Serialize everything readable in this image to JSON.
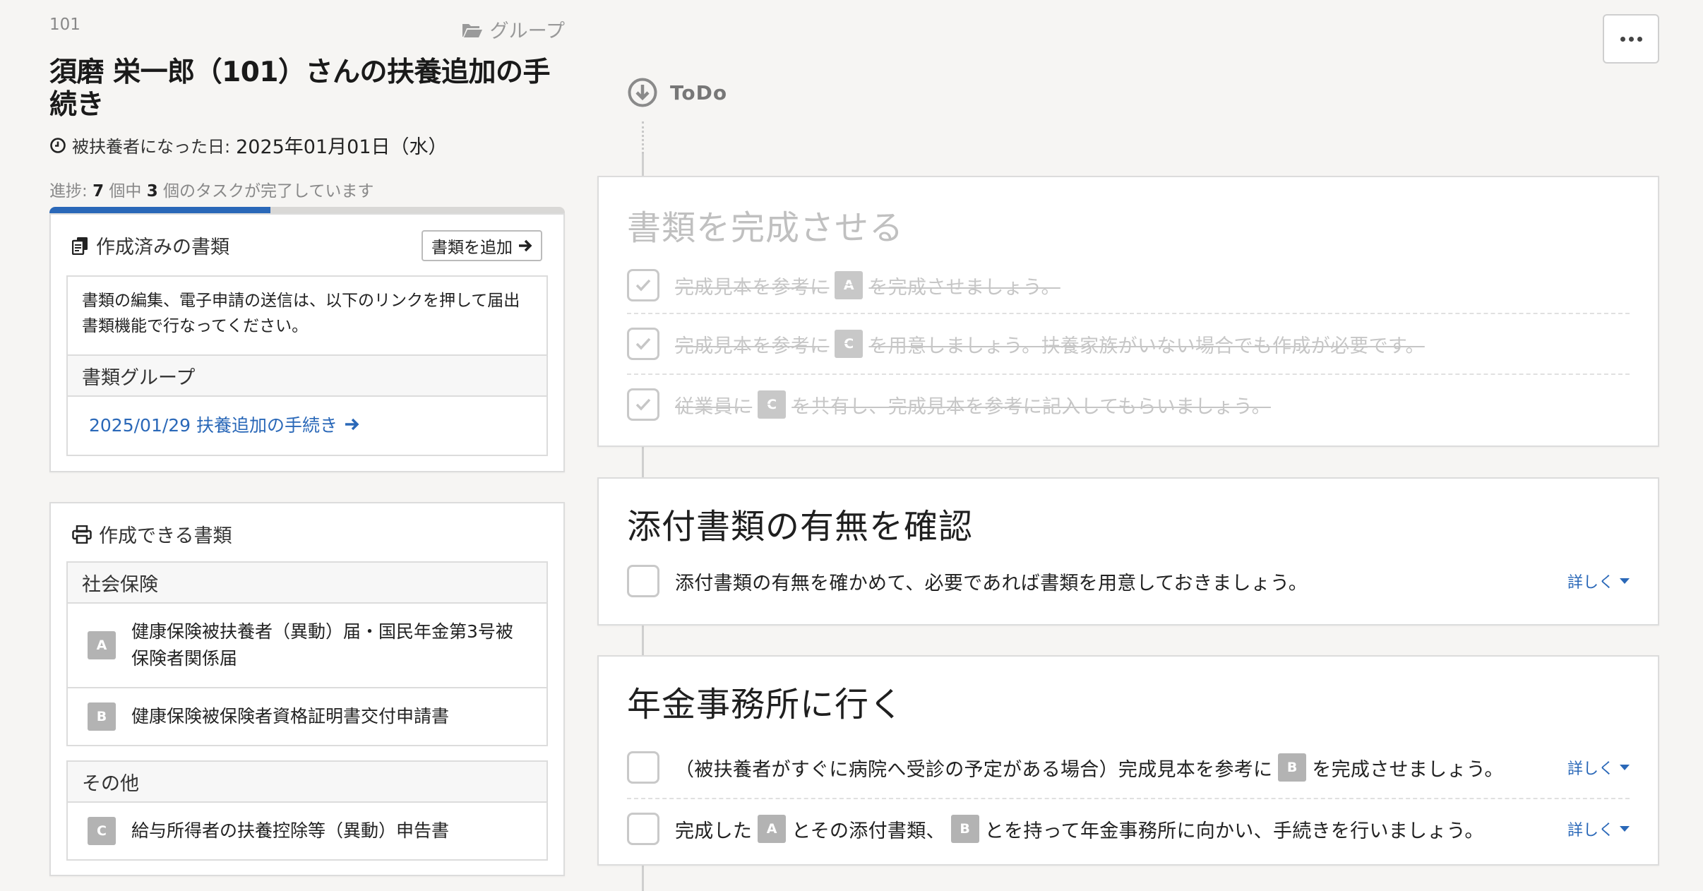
{
  "header": {
    "employee_id": "101",
    "group_label": "グループ",
    "title": "須磨 栄一郎（101）さんの扶養追加の手続き",
    "date_label": "被扶養者になった日:",
    "date_value": "2025年01月01日（水）",
    "progress": {
      "prefix": "進捗:",
      "total": "7",
      "mid": "個中",
      "done": "3",
      "suffix": "個のタスクが完了しています",
      "fraction": 0.4286
    }
  },
  "docs_made": {
    "title": "作成済みの書類",
    "add_button": "書類を追加",
    "description": "書類の編集、電子申請の送信は、以下のリンクを押して届出書類機能で行なってください。",
    "group_header": "書類グループ",
    "link_text": "2025/01/29 扶養追加の手続き"
  },
  "docs_can": {
    "title": "作成できる書類",
    "sections": [
      {
        "name": "社会保険",
        "items": [
          {
            "badge": "A",
            "label": "健康保険被扶養者（異動）届・国民年金第3号被保険者関係届"
          },
          {
            "badge": "B",
            "label": "健康保険被保険者資格証明書交付申請書"
          }
        ]
      },
      {
        "name": "その他",
        "items": [
          {
            "badge": "C",
            "label": "給与所得者の扶養控除等（異動）申告書"
          }
        ]
      }
    ]
  },
  "timeline": {
    "todo_label": "ToDo",
    "cards": [
      {
        "title": "書類を完成させる",
        "tasks": [
          {
            "pre": "完成見本を参考に",
            "badge": "A",
            "post": "を完成させましょう。",
            "done": true
          },
          {
            "pre": "完成見本を参考に",
            "badge": "C",
            "post": "を用意しましょう。扶養家族がいない場合でも作成が必要です。",
            "done": true
          },
          {
            "pre": "従業員に",
            "badge": "C",
            "post": "を共有し、完成見本を参考に記入してもらいましょう。",
            "done": true
          }
        ]
      },
      {
        "title": "添付書類の有無を確認",
        "tasks": [
          {
            "text": "添付書類の有無を確かめて、必要であれば書類を用意しておきましょう。",
            "detail": "詳しく",
            "done": false
          }
        ]
      },
      {
        "title": "年金事務所に行く",
        "tasks": [
          {
            "pre": "（被扶養者がすぐに病院へ受診の予定がある場合）完成見本を参考に",
            "badge": "B",
            "post": "を完成させましょう。",
            "detail": "詳しく",
            "done": false
          },
          {
            "pre": "完成した",
            "badge": "A",
            "mid": "とその添付書類、",
            "badge2": "B",
            "post": "とを持って年金事務所に向かい、手続きを行いましょう。",
            "detail": "詳しく",
            "done": false
          }
        ]
      }
    ]
  },
  "colors": {
    "accent": "#2a68b8",
    "badge_gray": "#b3b3b3",
    "background": "#f6f5f3"
  }
}
